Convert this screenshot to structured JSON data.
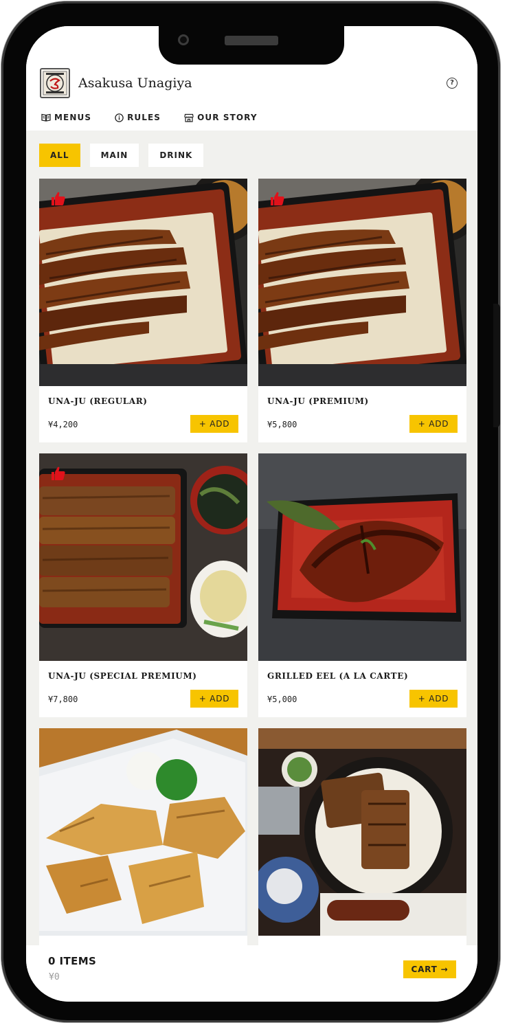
{
  "header": {
    "brand": "Asakusa Unagiya",
    "help_icon": "question-circle-icon"
  },
  "nav": [
    {
      "label": "MENUS",
      "icon": "book-icon"
    },
    {
      "label": "RULES",
      "icon": "info-circle-icon"
    },
    {
      "label": "OUR STORY",
      "icon": "storefront-icon"
    }
  ],
  "filters": [
    {
      "label": "ALL",
      "active": true
    },
    {
      "label": "MAIN",
      "active": false
    },
    {
      "label": "DRINK",
      "active": false
    }
  ],
  "menu_items": [
    {
      "name": "UNA-JU (REGULAR)",
      "price": "¥4,200",
      "add_label": "+ ADD",
      "recommended": true
    },
    {
      "name": "UNA-JU (PREMIUM)",
      "price": "¥5,800",
      "add_label": "+ ADD",
      "recommended": true
    },
    {
      "name": "UNA-JU (SPECIAL PREMIUM)",
      "price": "¥7,800",
      "add_label": "+ ADD",
      "recommended": true
    },
    {
      "name": "GRILLED EEL (A LA CARTE)",
      "price": "¥5,000",
      "add_label": "+ ADD",
      "recommended": false
    }
  ],
  "cart": {
    "items_label": "0 ITEMS",
    "total": "¥0",
    "button_label": "CART →"
  },
  "colors": {
    "accent": "#f7c400",
    "background": "#f1f1ee",
    "recommend_icon": "#e0121b"
  }
}
